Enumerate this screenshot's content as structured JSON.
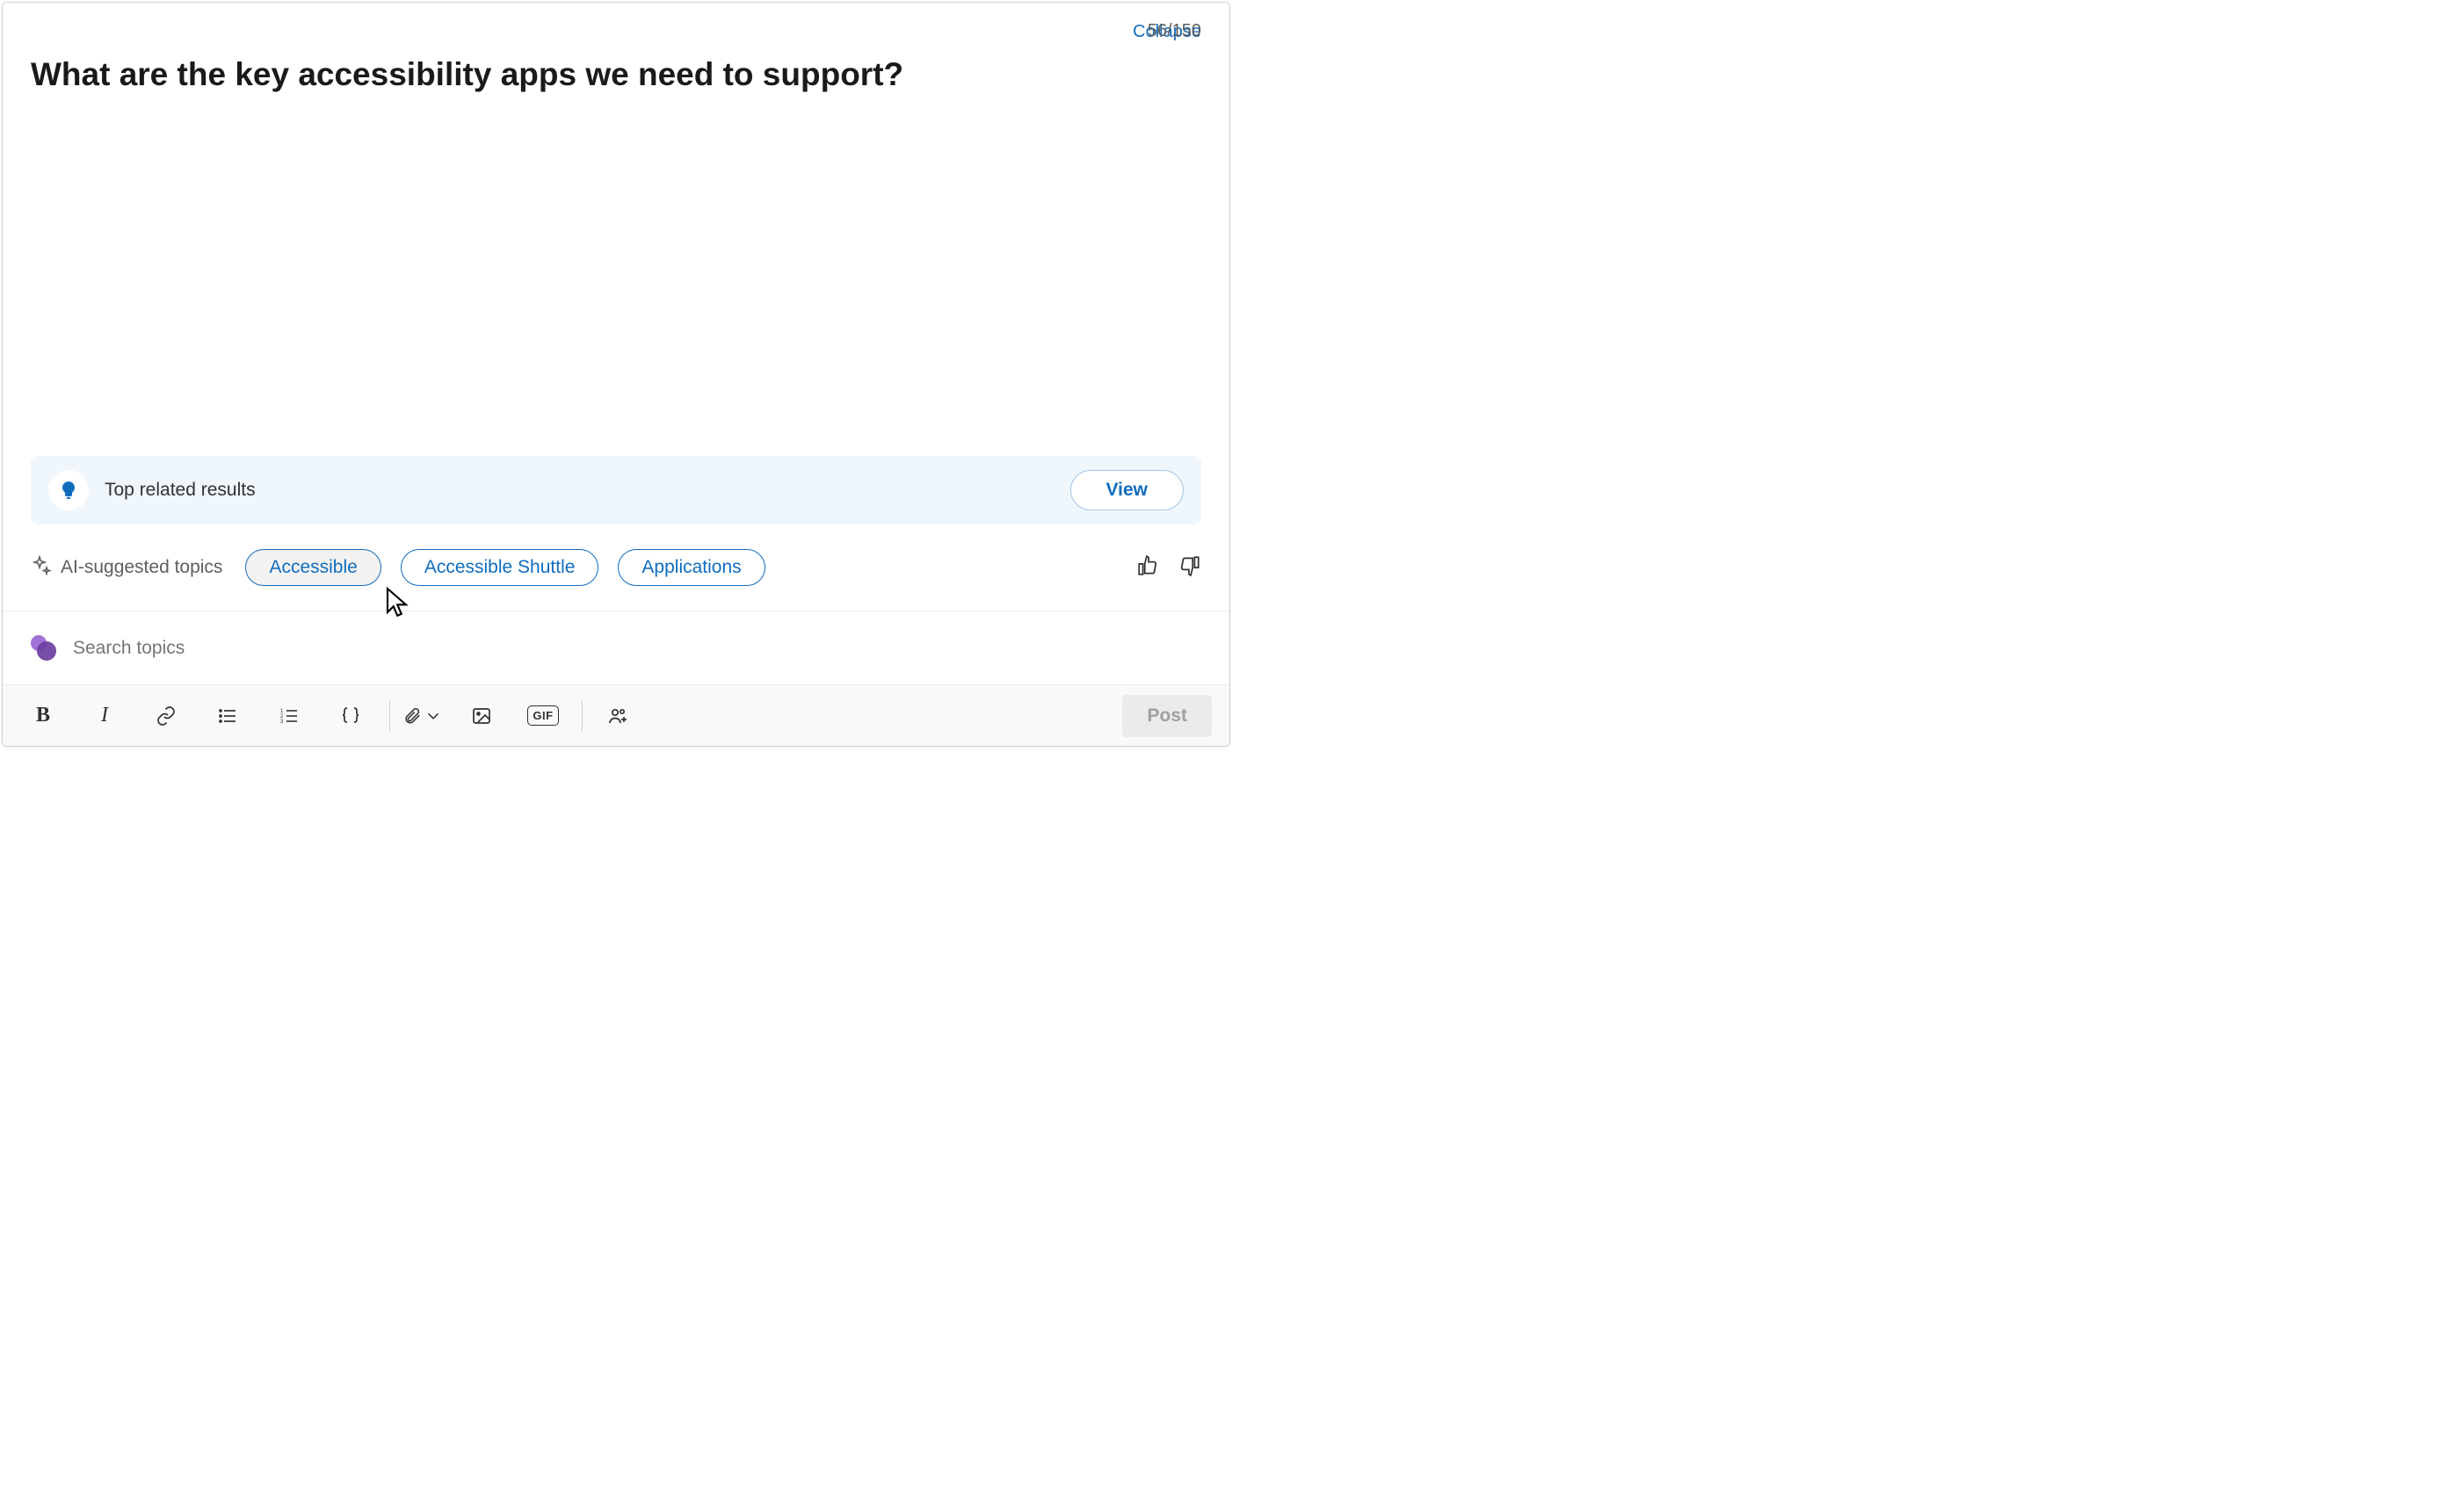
{
  "header": {
    "collapse": "Collapse",
    "title": "What are the key accessibility apps we need to support?",
    "counter": "56/150"
  },
  "related": {
    "label": "Top related results",
    "view": "View"
  },
  "ai": {
    "label": "AI-suggested topics",
    "chips": [
      "Accessible",
      "Accessible Shuttle",
      "Applications"
    ]
  },
  "search": {
    "placeholder": "Search topics"
  },
  "toolbar": {
    "bold": "B",
    "italic": "I",
    "gif": "GIF",
    "post": "Post"
  }
}
